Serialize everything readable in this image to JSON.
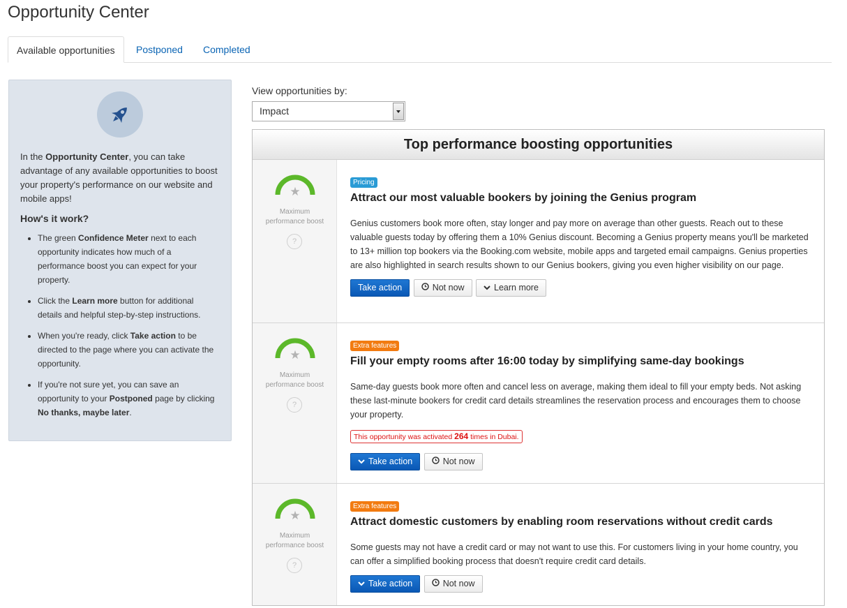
{
  "page_title": "Opportunity Center",
  "tabs": [
    {
      "label": "Available opportunities",
      "active": true
    },
    {
      "label": "Postponed",
      "active": false
    },
    {
      "label": "Completed",
      "active": false
    }
  ],
  "sidebar": {
    "icon": "rocket-icon",
    "intro_before": "In the ",
    "intro_bold": "Opportunity Center",
    "intro_after": ", you can take advantage of any available opportunities to boost your property's performance on our website and mobile apps!",
    "how_title": "How's it work?",
    "items": [
      {
        "before": "The green ",
        "bold": "Confidence Meter",
        "after": " next to each opportunity indicates how much of a performance boost you can expect for your property."
      },
      {
        "before": "Click the ",
        "bold": "Learn more",
        "after": " button for additional details and helpful step-by-step instructions."
      },
      {
        "before": "When you're ready, click ",
        "bold": "Take action",
        "after": " to be directed to the page where you can activate the opportunity."
      },
      {
        "before": "If you're not sure yet, you can save an opportunity to your ",
        "bold": "Postponed",
        "after": " page by clicking "
      }
    ],
    "last_bold": "No thanks, maybe later",
    "last_end": "."
  },
  "filter": {
    "label": "View opportunities by:",
    "selected": "Impact"
  },
  "panel_title": "Top performance boosting opportunities",
  "meter": {
    "label_line1": "Maximum",
    "label_line2": "performance boost",
    "help": "?",
    "star": "★"
  },
  "opportunities": [
    {
      "tag": "Pricing",
      "tag_color": "#2a9bd5",
      "title": "Attract our most valuable bookers by joining the Genius program",
      "description": "Genius customers book more often, stay longer and pay more on average than other guests. Reach out to these valuable guests today by offering them a 10% Genius discount. Becoming a Genius property means you'll be marketed to 13+ million top bookers via the Booking.com website, mobile apps and targeted email campaigns. Genius properties are also highlighted in search results shown to our Genius bookers, giving you even higher visibility on our page.",
      "take_action": "Take action",
      "not_now": "Not now",
      "learn_more": "Learn more"
    },
    {
      "tag": "Extra features",
      "tag_color": "#f27b10",
      "title": "Fill your empty rooms after 16:00 today by simplifying same-day bookings",
      "description": "Same-day guests book more often and cancel less on average, making them ideal to fill your empty beds. Not asking these last-minute bookers for credit card details streamlines the reservation process and encourages them to choose your property.",
      "notice_before": "This opportunity was activated ",
      "notice_count": "264",
      "notice_after": " times in Dubai.",
      "take_action": "Take action",
      "not_now": "Not now"
    },
    {
      "tag": "Extra features",
      "tag_color": "#f27b10",
      "title": "Attract domestic customers by enabling room reservations without credit cards",
      "description": "Some guests may not have a credit card or may not want to use this. For customers living in your home country, you can offer a simplified booking process that doesn't require credit card details.",
      "take_action": "Take action",
      "not_now": "Not now"
    }
  ]
}
